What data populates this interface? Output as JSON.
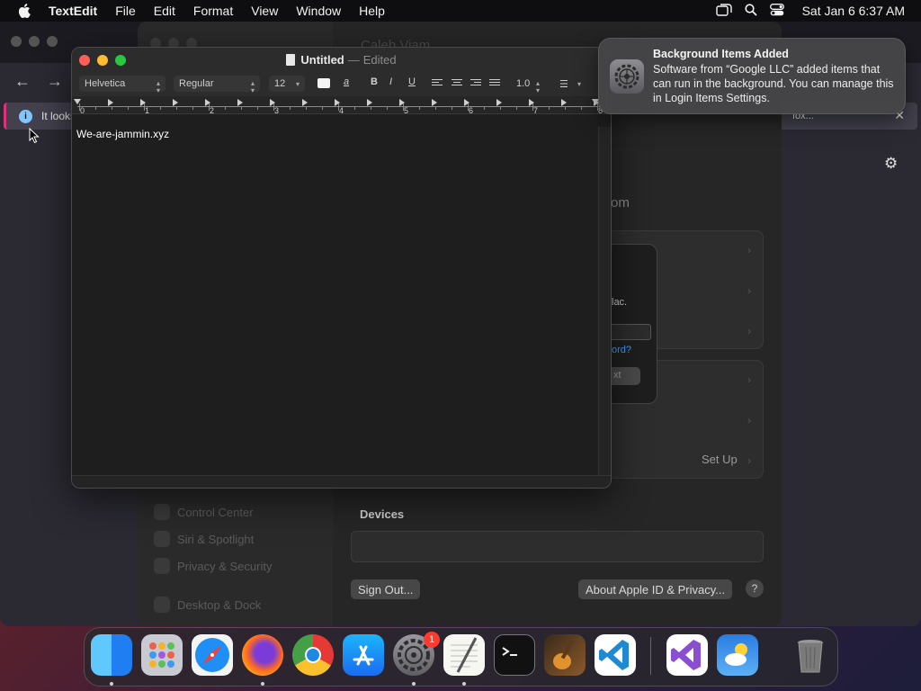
{
  "menubar": {
    "app_name": "TextEdit",
    "items": [
      "File",
      "Edit",
      "Format",
      "View",
      "Window",
      "Help"
    ],
    "clock": "Sat Jan 6  6:37 AM"
  },
  "browser": {
    "infobar_text": "It looks",
    "infobar_right_fragment": "fox...",
    "close_glyph": "✕"
  },
  "settings": {
    "title_fragment": "Caleb Viam",
    "heading_fragment": "om",
    "dialog_fragments": [
      "lac.",
      "ord?",
      "xt"
    ],
    "setup_label": "Set Up",
    "devices_label": "Devices",
    "sign_out_label": "Sign Out...",
    "about_label": "About Apple ID & Privacy...",
    "help_label": "?",
    "sidebar_items": [
      "Control Center",
      "Siri & Spotlight",
      "Privacy & Security",
      "Desktop & Dock"
    ]
  },
  "textedit": {
    "doc_name": "Untitled",
    "separator": "—",
    "doc_state": "Edited",
    "font_family": "Helvetica",
    "font_style": "Regular",
    "font_size": "12",
    "bold": "B",
    "italic": "I",
    "underline": "U",
    "line_spacing": "1.0",
    "text_color_glyph": "a",
    "ruler_numbers": [
      "0",
      "1",
      "2",
      "3",
      "4",
      "5",
      "6",
      "7",
      "8"
    ],
    "content": "We-are-jammin.xyz"
  },
  "notification": {
    "title": "Background Items Added",
    "body": "Software from “Google LLC” added items that can run in the background. You can manage this in Login Items Settings."
  },
  "dock": {
    "apps": [
      "Finder",
      "Launchpad",
      "Safari",
      "Firefox",
      "Chrome",
      "App Store",
      "System Settings",
      "TextEdit",
      "Terminal",
      "GarageBand",
      "VS Code",
      "Visual Studio",
      "Weather",
      "Trash"
    ],
    "settings_badge": "1"
  },
  "colors": {
    "close": "#ff5f57",
    "minimize": "#febc2e",
    "zoom": "#28c840",
    "accent": "#3aa3ff",
    "badge": "#ff3b30"
  }
}
